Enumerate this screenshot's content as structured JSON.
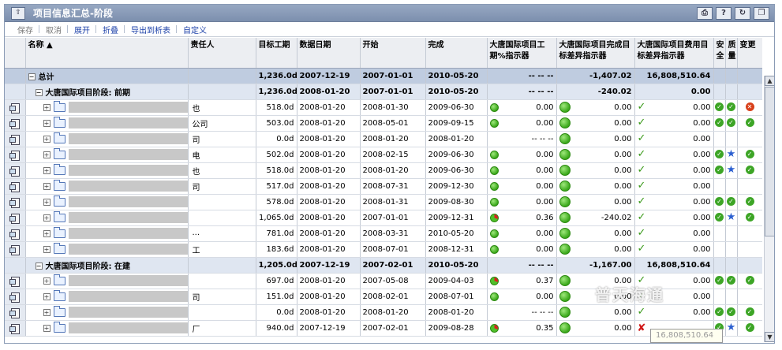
{
  "window": {
    "title": "项目信息汇总-阶段"
  },
  "toolbar": [
    "保存",
    "取消",
    "展开",
    "折叠",
    "导出到析表",
    "自定义"
  ],
  "columns": {
    "name": "名称",
    "owner": "责任人",
    "target": "目标工期",
    "data_date": "数据日期",
    "start": "开始",
    "finish": "完成",
    "ind_schedule": "大唐国际项目工期%指示器",
    "ind_finish": "大唐国际项目完成目标差异指示器",
    "ind_cost": "大唐国际项目费用目标差异指示器",
    "safe": "安全",
    "quality": "质量",
    "change": "变更"
  },
  "total": {
    "name": "总计",
    "target": "1,236.0d",
    "data_date": "2007-12-19",
    "start": "2007-01-01",
    "finish": "2010-05-20",
    "ind1": "-- -- --",
    "ind2": "-1,407.02",
    "ind3": "16,808,510.64"
  },
  "phase1": {
    "name": "大唐国际项目阶段: 前期",
    "target": "1,236.0d",
    "data_date": "2008-01-20",
    "start": "2007-01-01",
    "finish": "2010-05-20",
    "ind1": "-- -- --",
    "ind2": "-240.02",
    "ind3": "0.00"
  },
  "phase2": {
    "name": "大唐国际项目阶段: 在建",
    "target": "1,205.0d",
    "data_date": "2007-12-19",
    "start": "2007-02-01",
    "finish": "2010-05-20",
    "ind1": "-- -- --",
    "ind2": "-1,167.00",
    "ind3": "16,808,510.64"
  },
  "rows": [
    {
      "trail": "也",
      "target": "518.0d",
      "data_date": "2008-01-20",
      "start": "2008-01-30",
      "finish": "2009-06-30",
      "ind1": "0.00",
      "ind2": "0.00",
      "ind3": "0.00"
    },
    {
      "trail": "公司",
      "target": "503.0d",
      "data_date": "2008-01-20",
      "start": "2008-05-01",
      "finish": "2009-09-15",
      "ind1": "0.00",
      "ind2": "0.00",
      "ind3": "0.00"
    },
    {
      "trail": "司",
      "target": "0.0d",
      "data_date": "2008-01-20",
      "start": "2008-01-20",
      "finish": "2008-01-20",
      "ind1": "-- -- --",
      "ind2": "0.00",
      "ind3": "0.00"
    },
    {
      "trail": "电",
      "target": "502.0d",
      "data_date": "2008-01-20",
      "start": "2008-02-15",
      "finish": "2009-06-30",
      "ind1": "0.00",
      "ind2": "0.00",
      "ind3": "0.00"
    },
    {
      "trail": "也",
      "target": "518.0d",
      "data_date": "2008-01-20",
      "start": "2008-01-20",
      "finish": "2009-06-30",
      "ind1": "0.00",
      "ind2": "0.00",
      "ind3": "0.00"
    },
    {
      "trail": "司",
      "target": "517.0d",
      "data_date": "2008-01-20",
      "start": "2008-07-31",
      "finish": "2009-12-30",
      "ind1": "0.00",
      "ind2": "0.00",
      "ind3": "0.00"
    },
    {
      "trail": "",
      "target": "578.0d",
      "data_date": "2008-01-20",
      "start": "2008-01-31",
      "finish": "2009-08-30",
      "ind1": "0.00",
      "ind2": "0.00",
      "ind3": "0.00"
    },
    {
      "trail": "",
      "target": "1,065.0d",
      "data_date": "2008-01-20",
      "start": "2007-01-01",
      "finish": "2009-12-31",
      "ind1": "0.36",
      "ind2": "-240.02",
      "ind3": "0.00"
    },
    {
      "trail": "...",
      "target": "781.0d",
      "data_date": "2008-01-20",
      "start": "2008-03-31",
      "finish": "2010-05-20",
      "ind1": "0.00",
      "ind2": "0.00",
      "ind3": "0.00"
    },
    {
      "trail": "工",
      "target": "183.6d",
      "data_date": "2008-01-20",
      "start": "2008-07-01",
      "finish": "2008-12-31",
      "ind1": "0.00",
      "ind2": "0.00",
      "ind3": "0.00"
    },
    {
      "trail": "",
      "target": "697.0d",
      "data_date": "2008-01-20",
      "start": "2007-05-08",
      "finish": "2009-04-03",
      "ind1": "0.37",
      "ind2": "0.00",
      "ind3": "0.00"
    },
    {
      "trail": "司",
      "target": "151.0d",
      "data_date": "2008-01-20",
      "start": "2008-02-01",
      "finish": "2008-07-01",
      "ind1": "0.00",
      "ind2": "0.00",
      "ind3": "0.00"
    },
    {
      "trail": "",
      "target": "0.0d",
      "data_date": "2008-01-20",
      "start": "2008-01-20",
      "finish": "2008-01-20",
      "ind1": "-- -- --",
      "ind2": "0.00",
      "ind3": "0.00"
    },
    {
      "trail": "厂",
      "target": "940.0d",
      "data_date": "2007-12-19",
      "start": "2007-02-01",
      "finish": "2009-08-28",
      "ind1": "0.35",
      "ind2": "0.00",
      "ind3": ""
    }
  ],
  "overlay": {
    "watermark": "普天海通",
    "tooltip": "16,808,510.64"
  },
  "colors": {
    "titlebar": "#8a9bb5",
    "total_row": "#bfcce0",
    "phase_row": "#dfe6f1",
    "link": "#1a3fa8"
  }
}
